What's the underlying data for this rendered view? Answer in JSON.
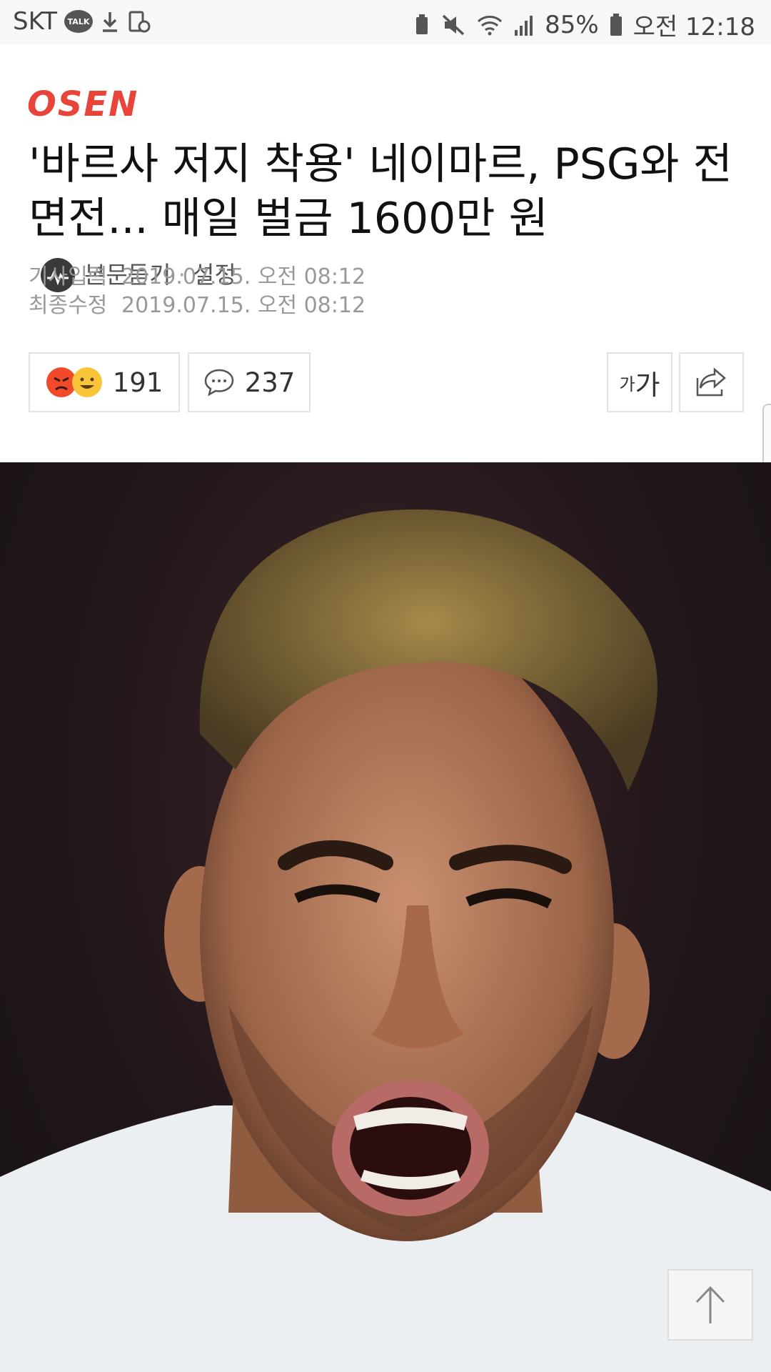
{
  "status_bar": {
    "carrier": "SKT",
    "talk_badge": "TALK",
    "battery": "85%",
    "time": "오전 12:18"
  },
  "header": {
    "logo": "OSEN",
    "title": "'바르사 저지 착용' 네이마르, PSG와 전면전... 매일 벌금 1600만 원",
    "listen_label": "본문듣기",
    "settings_label": "설정"
  },
  "meta": {
    "published_key": "기사입력",
    "published_value": "2019.07.15. 오전 08:12",
    "modified_key": "최종수정",
    "modified_value": "2019.07.15. 오전 08:12"
  },
  "actions": {
    "reaction_count": "191",
    "comment_count": "237",
    "font_size_label_small": "가",
    "font_size_label_big": "가"
  },
  "colors": {
    "logo": "#e8443a",
    "photo_bg": "#21171b"
  }
}
